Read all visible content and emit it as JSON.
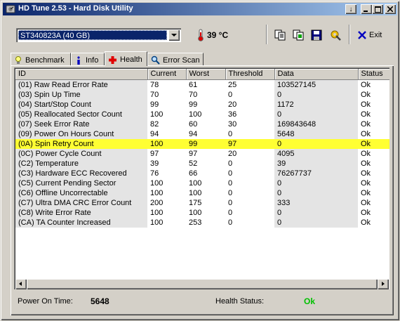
{
  "window": {
    "title": "HD Tune 2.53 - Hard Disk Utility",
    "controls": [
      "minimize",
      "maximize",
      "close"
    ]
  },
  "toolbar": {
    "drive_selected": "ST340823A (40 GB)",
    "temperature": "39 °C",
    "exit_label": "Exit",
    "icons": [
      "copy-text-icon",
      "copy-screenshot-icon",
      "save-icon",
      "options-icon",
      "exit-icon"
    ]
  },
  "tabs": [
    {
      "label": "Benchmark",
      "icon": "benchmark-icon"
    },
    {
      "label": "Info",
      "icon": "info-icon"
    },
    {
      "label": "Health",
      "icon": "health-cross-icon",
      "active": true
    },
    {
      "label": "Error Scan",
      "icon": "error-scan-icon"
    }
  ],
  "table": {
    "columns": [
      "ID",
      "Current",
      "Worst",
      "Threshold",
      "Data",
      "Status"
    ],
    "highlighted_row": 6,
    "highlight_color": "#ffff33",
    "rows": [
      [
        "(01) Raw Read Error Rate",
        "78",
        "61",
        "25",
        "103527145",
        "Ok"
      ],
      [
        "(03) Spin Up Time",
        "70",
        "70",
        "0",
        "0",
        "Ok"
      ],
      [
        "(04) Start/Stop Count",
        "99",
        "99",
        "20",
        "1172",
        "Ok"
      ],
      [
        "(05) Reallocated Sector Count",
        "100",
        "100",
        "36",
        "0",
        "Ok"
      ],
      [
        "(07) Seek Error Rate",
        "82",
        "60",
        "30",
        "169843648",
        "Ok"
      ],
      [
        "(09) Power On Hours Count",
        "94",
        "94",
        "0",
        "5648",
        "Ok"
      ],
      [
        "(0A) Spin Retry Count",
        "100",
        "99",
        "97",
        "0",
        "Ok"
      ],
      [
        "(0C) Power Cycle Count",
        "97",
        "97",
        "20",
        "4095",
        "Ok"
      ],
      [
        "(C2) Temperature",
        "39",
        "52",
        "0",
        "39",
        "Ok"
      ],
      [
        "(C3) Hardware ECC Recovered",
        "76",
        "66",
        "0",
        "76267737",
        "Ok"
      ],
      [
        "(C5) Current Pending Sector",
        "100",
        "100",
        "0",
        "0",
        "Ok"
      ],
      [
        "(C6) Offline Uncorrectable",
        "100",
        "100",
        "0",
        "0",
        "Ok"
      ],
      [
        "(C7) Ultra DMA CRC Error Count",
        "200",
        "175",
        "0",
        "333",
        "Ok"
      ],
      [
        "(C8) Write Error Rate",
        "100",
        "100",
        "0",
        "0",
        "Ok"
      ],
      [
        "(CA) TA Counter Increased",
        "100",
        "253",
        "0",
        "0",
        "Ok"
      ]
    ]
  },
  "footer": {
    "power_on_label": "Power On Time:",
    "power_on_value": "5648",
    "health_label": "Health Status:",
    "health_value": "Ok",
    "health_color": "#00c000"
  }
}
